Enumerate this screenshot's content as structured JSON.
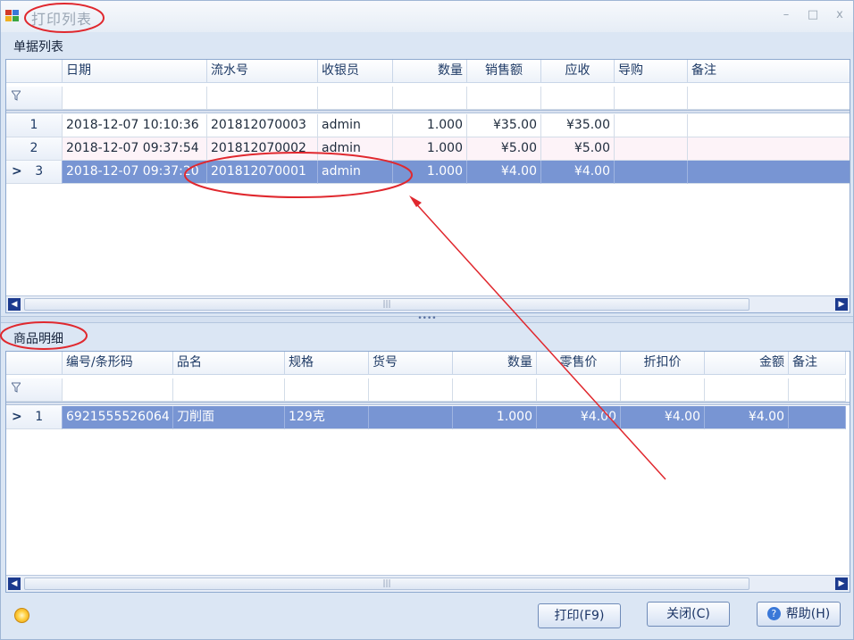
{
  "window": {
    "title": "打印列表",
    "minimize": "–",
    "maximize": "□",
    "close": "x"
  },
  "orders": {
    "group_title": "单据列表",
    "columns": [
      "",
      "日期",
      "流水号",
      "收银员",
      "数量",
      "销售额",
      "应收",
      "导购",
      "备注"
    ],
    "rows": [
      {
        "index": "1",
        "date": "2018-12-07 10:10:36",
        "serial": "201812070003",
        "cashier": "admin",
        "qty": "1.000",
        "sales": "¥35.00",
        "receivable": "¥35.00",
        "guide": "",
        "note": ""
      },
      {
        "index": "2",
        "date": "2018-12-07 09:37:54",
        "serial": "201812070002",
        "cashier": "admin",
        "qty": "1.000",
        "sales": "¥5.00",
        "receivable": "¥5.00",
        "guide": "",
        "note": ""
      },
      {
        "index": "3",
        "date": "2018-12-07 09:37:20",
        "serial": "201812070001",
        "cashier": "admin",
        "qty": "1.000",
        "sales": "¥4.00",
        "receivable": "¥4.00",
        "guide": "",
        "note": ""
      }
    ],
    "selected_marker": ">"
  },
  "items": {
    "group_title": "商品明细",
    "columns": [
      "",
      "编号/条形码",
      "品名",
      "规格",
      "货号",
      "数量",
      "零售价",
      "折扣价",
      "金额",
      "备注"
    ],
    "rows": [
      {
        "index": "1",
        "code": "6921555526064",
        "name": "刀削面",
        "spec": "129克",
        "sku": "",
        "qty": "1.000",
        "retail": "¥4.00",
        "discount": "¥4.00",
        "amount": "¥4.00",
        "note": ""
      }
    ],
    "selected_marker": ">"
  },
  "scroll": {
    "thumb_grip": "|||",
    "left_arrow": "◀",
    "right_arrow": "▶"
  },
  "splitter_grip": "••••",
  "buttons": {
    "print": "打印(F9)",
    "close": "关闭(C)",
    "help": "帮助(H)",
    "help_icon_glyph": "?"
  },
  "icons": {
    "filter": "funnel-icon",
    "status": "bulb-icon"
  },
  "annotation_color": "#e0282e"
}
